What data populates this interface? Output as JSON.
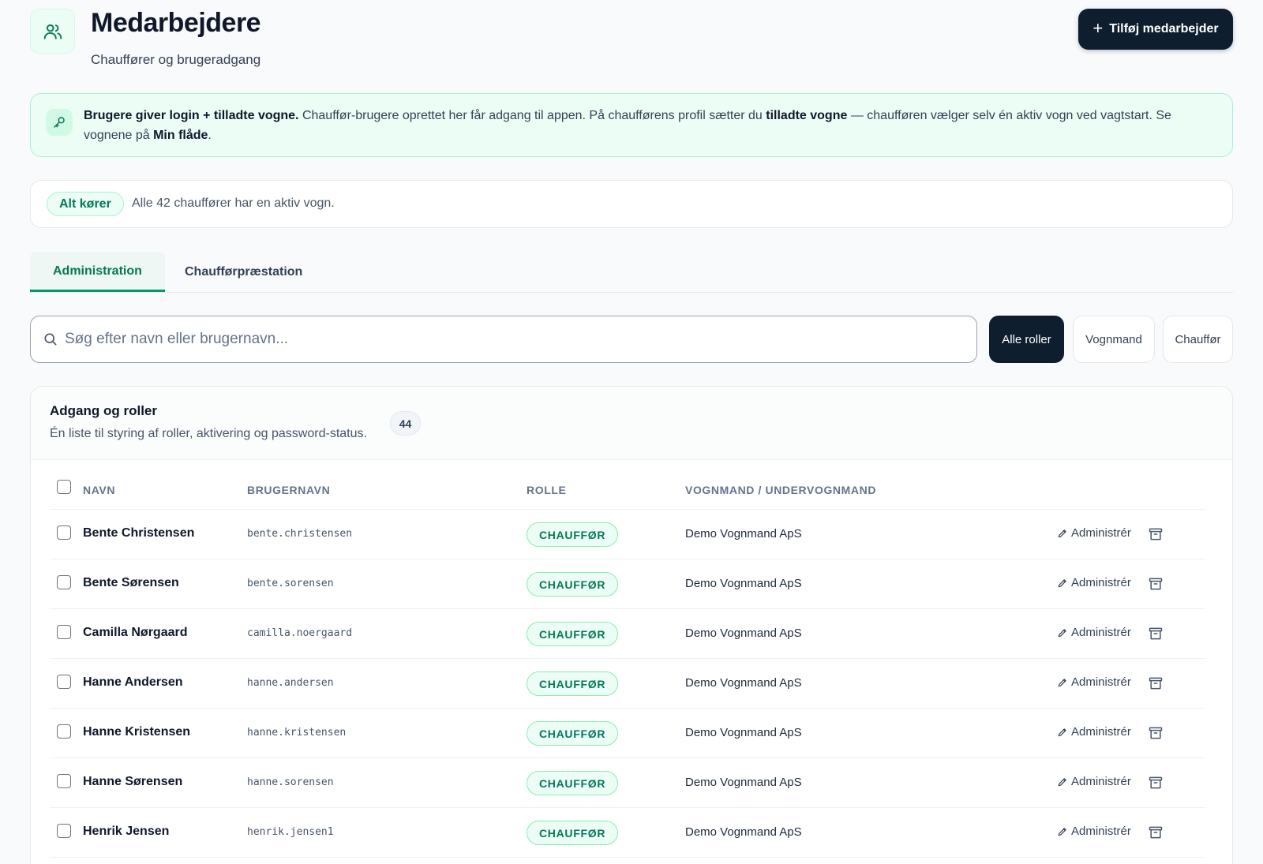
{
  "header": {
    "title": "Medarbejdere",
    "subtitle": "Chauffører og brugeradgang",
    "add_button": "Tilføj medarbejder",
    "icon": "users-icon"
  },
  "info": {
    "icon": "key-icon",
    "bold_lead": "Brugere giver login + tilladte vogne.",
    "text_1": " Chauffør-brugere oprettet her får adgang til appen. På chaufførens profil sætter du ",
    "bold_2": "tilladte vogne",
    "text_2": " — chaufføren vælger selv én aktiv vogn ved vagtstart. Se vognene på ",
    "bold_3": "Min flåde",
    "text_3": "."
  },
  "status": {
    "pill": "Alt kører",
    "text": "Alle 42 chauffører har en aktiv vogn."
  },
  "tabs": [
    {
      "label": "Administration",
      "active": true
    },
    {
      "label": "Chaufførpræstation",
      "active": false
    }
  ],
  "search": {
    "placeholder": "Søg efter navn eller brugernavn...",
    "value": ""
  },
  "role_filters": [
    {
      "label": "Alle roller",
      "active": true
    },
    {
      "label": "Vognmand",
      "active": false
    },
    {
      "label": "Chauffør",
      "active": false
    }
  ],
  "table_card": {
    "title": "Adgang og roller",
    "description": "Én liste til styring af roller, aktivering og password-status.",
    "count": "44",
    "columns": [
      "NAVN",
      "BRUGERNAVN",
      "ROLLE",
      "VOGNMAND / UNDERVOGNMAND"
    ],
    "action_label": "Administrér",
    "rows": [
      {
        "name": "Bente Christensen",
        "username": "bente.christensen",
        "role": "CHAUFFØR",
        "company": "Demo Vognmand ApS"
      },
      {
        "name": "Bente Sørensen",
        "username": "bente.sorensen",
        "role": "CHAUFFØR",
        "company": "Demo Vognmand ApS"
      },
      {
        "name": "Camilla Nørgaard",
        "username": "camilla.noergaard",
        "role": "CHAUFFØR",
        "company": "Demo Vognmand ApS"
      },
      {
        "name": "Hanne Andersen",
        "username": "hanne.andersen",
        "role": "CHAUFFØR",
        "company": "Demo Vognmand ApS"
      },
      {
        "name": "Hanne Kristensen",
        "username": "hanne.kristensen",
        "role": "CHAUFFØR",
        "company": "Demo Vognmand ApS"
      },
      {
        "name": "Hanne Sørensen",
        "username": "hanne.sorensen",
        "role": "CHAUFFØR",
        "company": "Demo Vognmand ApS"
      },
      {
        "name": "Henrik Jensen",
        "username": "henrik.jensen1",
        "role": "CHAUFFØR",
        "company": "Demo Vognmand ApS"
      }
    ]
  },
  "colors": {
    "accent": "#047857",
    "accent_bg": "#ecfdf5",
    "dark_button": "#0f1e2e"
  }
}
